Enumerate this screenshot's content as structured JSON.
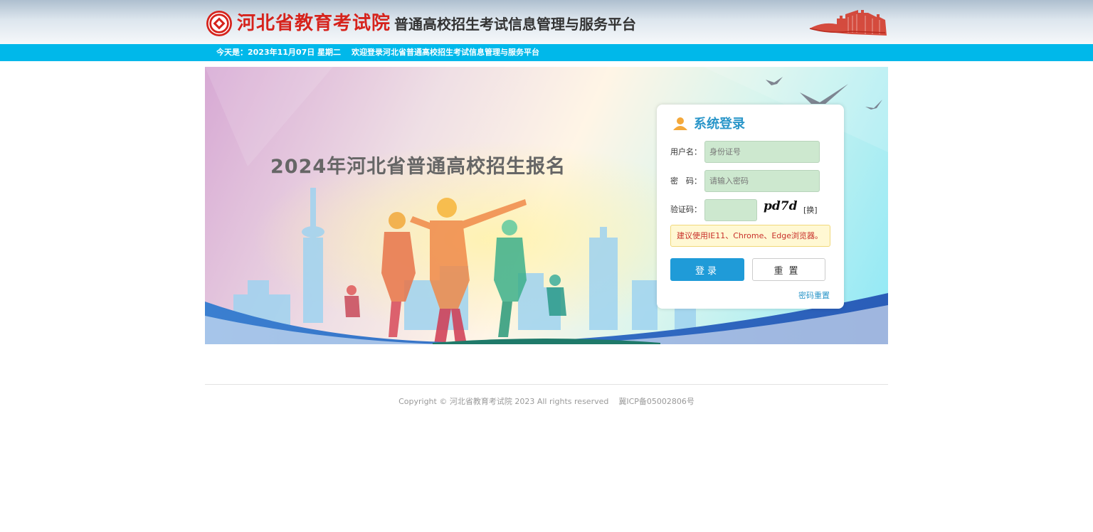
{
  "header": {
    "org_name": "河北省教育考试院",
    "platform_name": "普通高校招生考试信息管理与服务平台",
    "logo_icon": "exam-authority-seal-icon",
    "decoration_icon": "great-wall-icon",
    "brand_red": "#d6231c"
  },
  "infobar": {
    "date_text": "今天是：2023年11月07日 星期二",
    "welcome_text": "欢迎登录河北省普通高校招生考试信息管理与服务平台",
    "color": "#00b8ea"
  },
  "banner": {
    "title": "2024年河北省普通高校招生报名"
  },
  "login": {
    "title": "系统登录",
    "username_label": "用户名：",
    "username_placeholder": "身份证号",
    "username_value": "",
    "password_label": "密　码：",
    "password_placeholder": "请输入密码",
    "password_value": "",
    "captcha_label": "验证码：",
    "captcha_value": "",
    "captcha_text": "pd7d",
    "refresh_label": "[换]",
    "browser_notice": "建议使用IE11、Chrome、Edge浏览器。",
    "login_button": "登录",
    "reset_button": "重置",
    "password_reset_link": "密码重置",
    "accent": "#1f9bd8"
  },
  "footer": {
    "copyright": "Copyright © 河北省教育考试院 2023 All rights reserved",
    "icp": "冀ICP备05002806号"
  }
}
